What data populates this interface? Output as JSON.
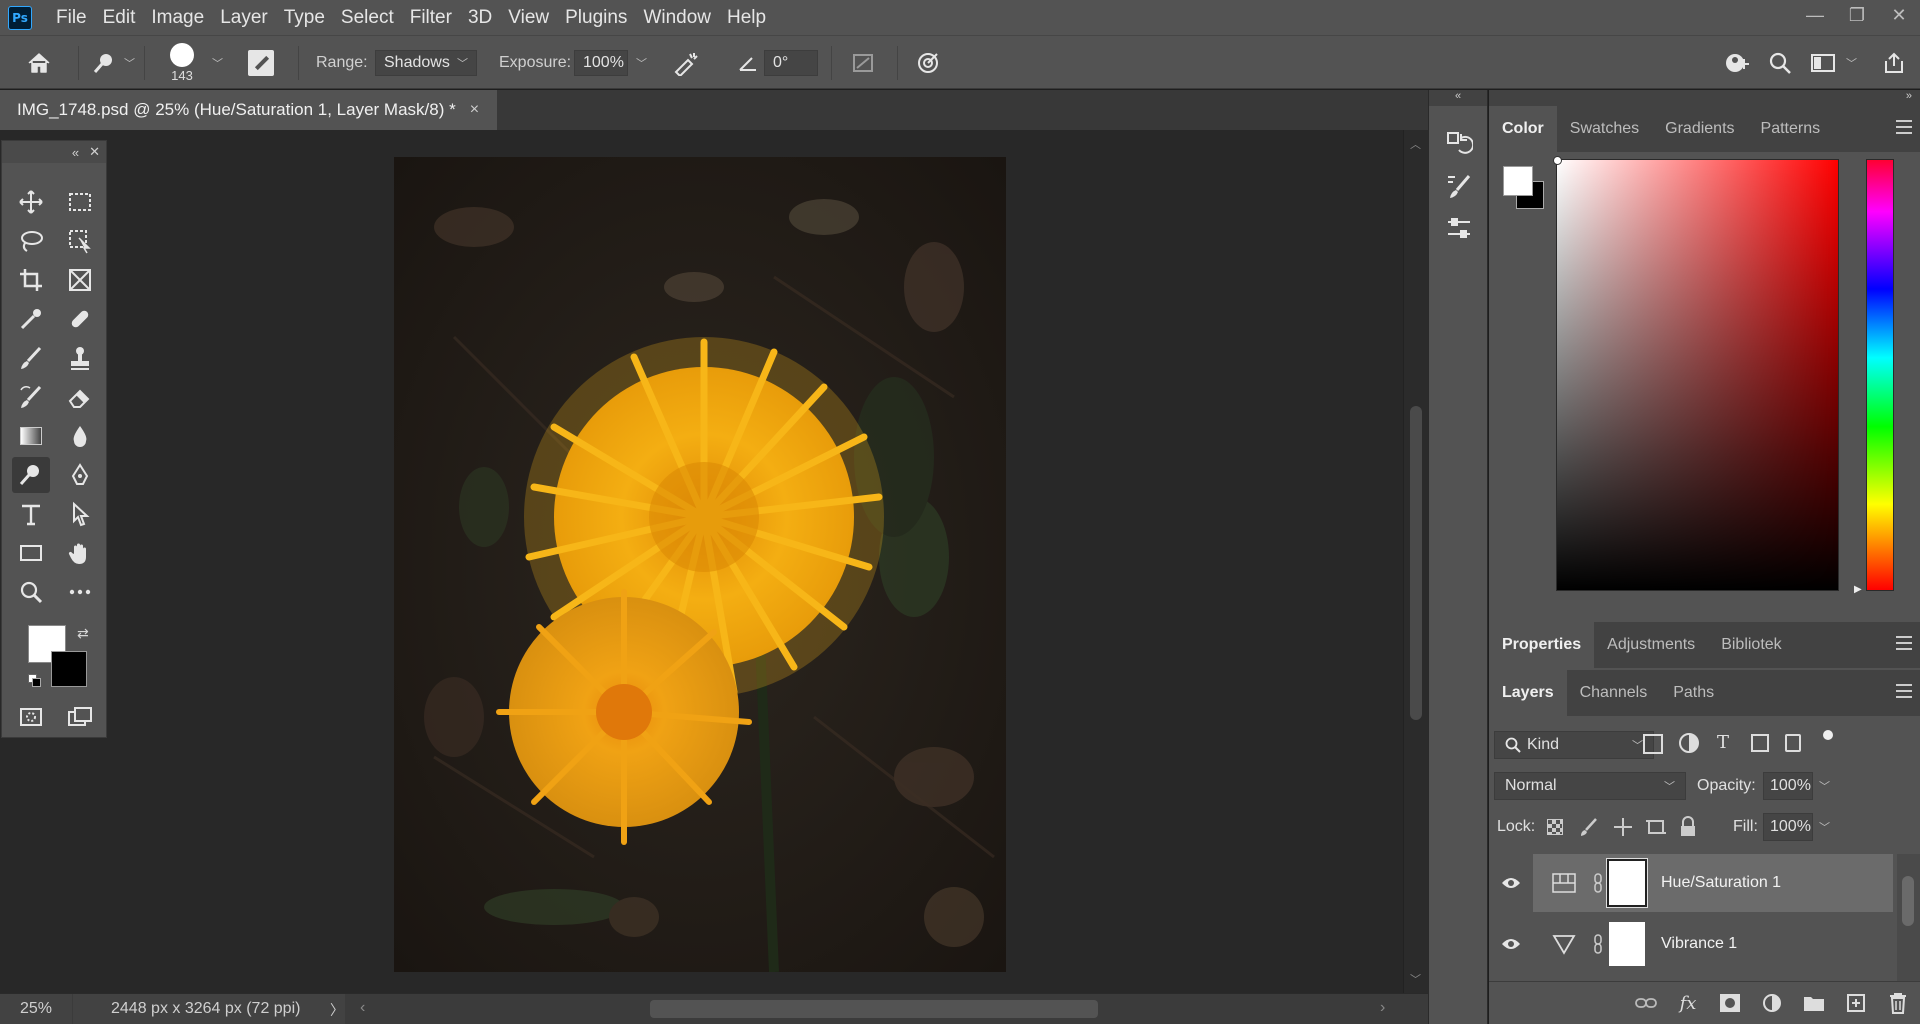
{
  "app": {
    "logo": "Ps"
  },
  "menu": [
    "File",
    "Edit",
    "Image",
    "Layer",
    "Type",
    "Select",
    "Filter",
    "3D",
    "View",
    "Plugins",
    "Window",
    "Help"
  ],
  "window_controls": {
    "minimize": "—",
    "restore": "❐",
    "close": "✕"
  },
  "options_bar": {
    "brush_size": "143",
    "range_label": "Range:",
    "range_value": "Shadows",
    "exposure_label": "Exposure:",
    "exposure_value": "100%",
    "angle_value": "0°"
  },
  "document": {
    "tab_title": "IMG_1748.psd @ 25% (Hue/Saturation 1, Layer Mask/8) *",
    "tab_close": "×"
  },
  "status": {
    "zoom": "25%",
    "doc_info": "2448 px x 3264 px (72 ppi)",
    "arrow": "〉"
  },
  "toolbar": {
    "collapse": "«",
    "close": "✕"
  },
  "color_panel": {
    "tabs": [
      "Color",
      "Swatches",
      "Gradients",
      "Patterns"
    ],
    "foreground": "#ffffff",
    "background": "#000000"
  },
  "properties_panel": {
    "tabs": [
      "Properties",
      "Adjustments",
      "Bibliotek"
    ]
  },
  "layers_panel": {
    "tabs": [
      "Layers",
      "Channels",
      "Paths"
    ],
    "filter_kind": "Kind",
    "blend_mode": "Normal",
    "opacity_label": "Opacity:",
    "opacity_value": "100%",
    "lock_label": "Lock:",
    "fill_label": "Fill:",
    "fill_value": "100%",
    "layers": [
      {
        "name": "Hue/Saturation 1",
        "selected": true
      },
      {
        "name": "Vibrance 1",
        "selected": false
      }
    ]
  },
  "colors": {
    "ui_bg": "#535353",
    "canvas_bg": "#282828",
    "flower": "#f2a90e"
  }
}
